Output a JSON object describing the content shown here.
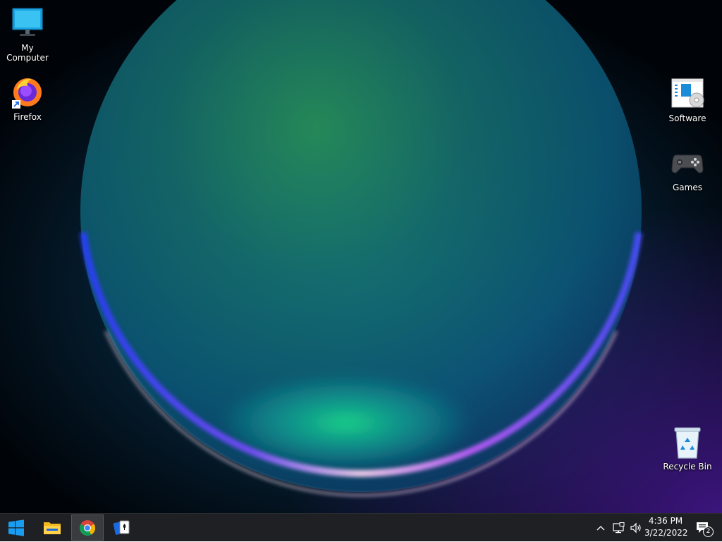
{
  "desktop": {
    "icons_left": [
      {
        "label": "My Computer",
        "icon": "monitor-icon"
      },
      {
        "label": "Firefox",
        "icon": "firefox-icon"
      }
    ],
    "icons_right": [
      {
        "label": "Software",
        "icon": "software-installer-icon"
      },
      {
        "label": "Games",
        "icon": "gamepad-icon"
      },
      {
        "label": "Recycle Bin",
        "icon": "recycle-bin-icon"
      }
    ]
  },
  "taskbar": {
    "start_icon": "windows-logo-icon",
    "pinned": [
      {
        "name": "File Explorer",
        "icon": "folder-icon",
        "active": false
      },
      {
        "name": "Google Chrome",
        "icon": "chrome-icon",
        "active": true
      },
      {
        "name": "Solitaire",
        "icon": "cards-icon",
        "active": false
      }
    ],
    "tray": {
      "icons": [
        "chevron-up-icon",
        "network-icon",
        "volume-icon"
      ],
      "time": "4:36 PM",
      "date": "3/22/2022",
      "notification_count": "2"
    }
  },
  "colors": {
    "taskbar_bg": "#1f2023",
    "active_button_bg": "#3a3b3f",
    "wallpaper_glow_green": "#16c07a",
    "wallpaper_glow_blue": "#1a4fd6",
    "wallpaper_glow_purple": "#7a3cff"
  }
}
